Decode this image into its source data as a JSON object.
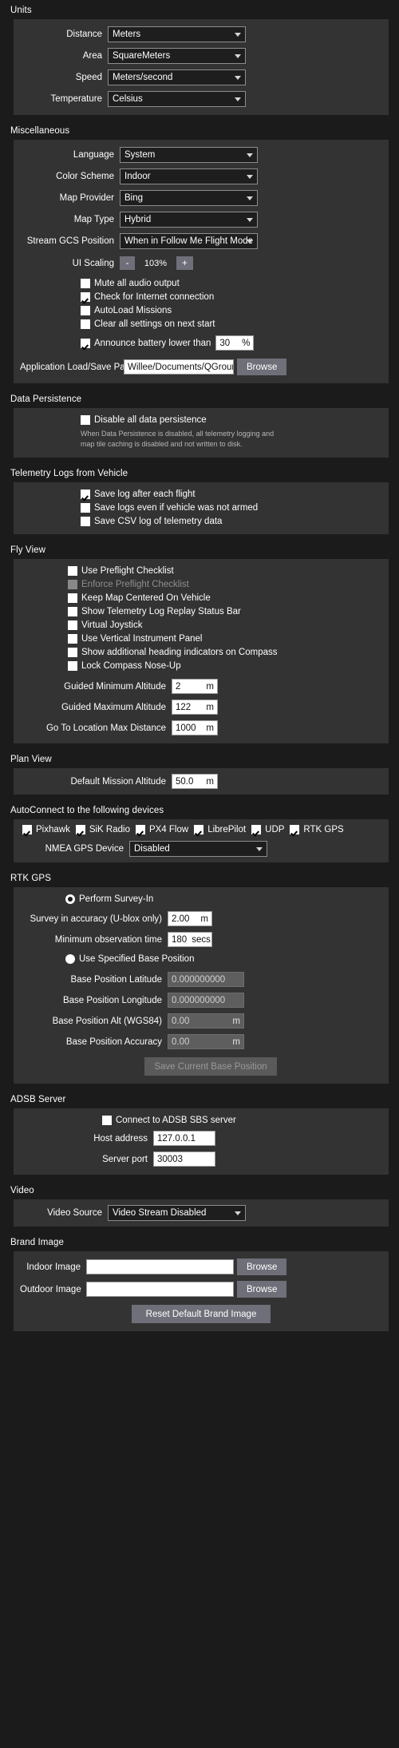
{
  "units": {
    "title": "Units",
    "rows": [
      {
        "label": "Distance",
        "value": "Meters"
      },
      {
        "label": "Area",
        "value": "SquareMeters"
      },
      {
        "label": "Speed",
        "value": "Meters/second"
      },
      {
        "label": "Temperature",
        "value": "Celsius"
      }
    ]
  },
  "misc": {
    "title": "Miscellaneous",
    "combos": [
      {
        "label": "Language",
        "value": "System"
      },
      {
        "label": "Color Scheme",
        "value": "Indoor"
      },
      {
        "label": "Map Provider",
        "value": "Bing"
      },
      {
        "label": "Map Type",
        "value": "Hybrid"
      },
      {
        "label": "Stream GCS Position",
        "value": "When in Follow Me Flight Mode"
      }
    ],
    "ui_scaling": {
      "label": "UI Scaling",
      "minus": "-",
      "value": "103%",
      "plus": "+"
    },
    "checks": [
      {
        "label": "Mute all audio output",
        "checked": false
      },
      {
        "label": "Check for Internet connection",
        "checked": true
      },
      {
        "label": "AutoLoad Missions",
        "checked": false
      },
      {
        "label": "Clear all settings on next start",
        "checked": false
      }
    ],
    "battery": {
      "label": "Announce battery lower than",
      "checked": true,
      "value": "30",
      "unit": "%"
    },
    "path": {
      "label": "Application Load/Save Path",
      "value": "Willee/Documents/QGroundControl",
      "browse": "Browse"
    }
  },
  "persistence": {
    "title": "Data Persistence",
    "check": {
      "label": "Disable all data persistence",
      "checked": false
    },
    "note": "When Data Persistence is disabled, all telemetry logging and map tile caching is disabled and not written to disk."
  },
  "telemetry": {
    "title": "Telemetry Logs from Vehicle",
    "checks": [
      {
        "label": "Save log after each flight",
        "checked": true
      },
      {
        "label": "Save logs even if vehicle was not armed",
        "checked": false
      },
      {
        "label": "Save CSV log of telemetry data",
        "checked": false
      }
    ]
  },
  "flyview": {
    "title": "Fly View",
    "checks": [
      {
        "label": "Use Preflight Checklist",
        "checked": false,
        "disabled": false
      },
      {
        "label": "Enforce Preflight Checklist",
        "checked": false,
        "disabled": true
      },
      {
        "label": "Keep Map Centered On Vehicle",
        "checked": false,
        "disabled": false
      },
      {
        "label": "Show Telemetry Log Replay Status Bar",
        "checked": false,
        "disabled": false
      },
      {
        "label": "Virtual Joystick",
        "checked": false,
        "disabled": false
      },
      {
        "label": "Use Vertical Instrument Panel",
        "checked": false,
        "disabled": false
      },
      {
        "label": "Show additional heading indicators on Compass",
        "checked": false,
        "disabled": false
      },
      {
        "label": "Lock Compass Nose-Up",
        "checked": false,
        "disabled": false
      }
    ],
    "fields": [
      {
        "label": "Guided Minimum Altitude",
        "value": "2",
        "unit": "m"
      },
      {
        "label": "Guided Maximum Altitude",
        "value": "122",
        "unit": "m"
      },
      {
        "label": "Go To Location Max Distance",
        "value": "1000",
        "unit": "m"
      }
    ]
  },
  "planview": {
    "title": "Plan View",
    "field": {
      "label": "Default Mission Altitude",
      "value": "50.0",
      "unit": "m"
    }
  },
  "autoconnect": {
    "title": "AutoConnect to the following devices",
    "devices": [
      {
        "label": "Pixhawk",
        "checked": true
      },
      {
        "label": "SiK Radio",
        "checked": true
      },
      {
        "label": "PX4 Flow",
        "checked": true
      },
      {
        "label": "LibrePilot",
        "checked": true
      },
      {
        "label": "UDP",
        "checked": true
      },
      {
        "label": "RTK GPS",
        "checked": true
      }
    ],
    "nmea": {
      "label": "NMEA GPS Device",
      "value": "Disabled"
    }
  },
  "rtk": {
    "title": "RTK GPS",
    "radio_survey": {
      "label": "Perform Survey-In",
      "selected": true
    },
    "survey_fields": [
      {
        "label": "Survey in accuracy (U-blox only)",
        "value": "2.00",
        "unit": "m"
      },
      {
        "label": "Minimum observation time",
        "value": "180",
        "unit": "secs"
      }
    ],
    "radio_base": {
      "label": "Use Specified Base Position",
      "selected": false
    },
    "base_fields": [
      {
        "label": "Base Position Latitude",
        "value": "0.000000000",
        "unit": ""
      },
      {
        "label": "Base Position Longitude",
        "value": "0.000000000",
        "unit": ""
      },
      {
        "label": "Base Position Alt (WGS84)",
        "value": "0.00",
        "unit": "m"
      },
      {
        "label": "Base Position Accuracy",
        "value": "0.00",
        "unit": "m"
      }
    ],
    "save_button": "Save Current Base Position"
  },
  "adsb": {
    "title": "ADSB Server",
    "check": {
      "label": "Connect to ADSB SBS server",
      "checked": false
    },
    "fields": [
      {
        "label": "Host address",
        "value": "127.0.0.1"
      },
      {
        "label": "Server port",
        "value": "30003"
      }
    ]
  },
  "video": {
    "title": "Video",
    "source": {
      "label": "Video Source",
      "value": "Video Stream Disabled"
    }
  },
  "brand": {
    "title": "Brand Image",
    "rows": [
      {
        "label": "Indoor Image",
        "value": "",
        "browse": "Browse"
      },
      {
        "label": "Outdoor Image",
        "value": "",
        "browse": "Browse"
      }
    ],
    "reset_button": "Reset Default Brand Image"
  },
  "colors": {
    "background": "#1b1b1b",
    "panel": "#333333",
    "text": "#ffffff",
    "button": "#6f6f7a",
    "field_bg": "#ffffff",
    "combo_bg": "#1e1e1e"
  }
}
